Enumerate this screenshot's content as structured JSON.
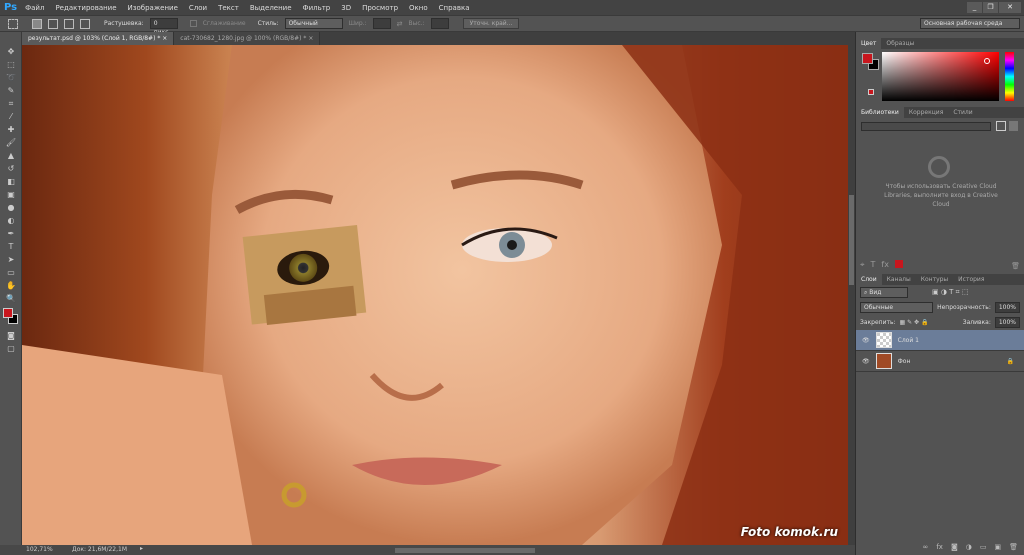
{
  "app": {
    "logo": "Ps",
    "window_buttons": [
      "_",
      "❐",
      "✕"
    ]
  },
  "menu": [
    "Файл",
    "Редактирование",
    "Изображение",
    "Слои",
    "Текст",
    "Выделение",
    "Фильтр",
    "3D",
    "Просмотр",
    "Окно",
    "Справка"
  ],
  "options": {
    "feather_label": "Растушевка:",
    "feather_value": "0 пикс.",
    "antialias": "Сглаживание",
    "style_label": "Стиль:",
    "style_value": "Обычный",
    "width_label": "Шир.:",
    "height_label": "Выс.:",
    "refine_edge": "Уточн. край...",
    "workspace": "Основная рабочая среда"
  },
  "tabs": [
    {
      "label": "результат.psd @ 103% (Слой 1, RGB/8#) *",
      "close": "×"
    },
    {
      "label": "cat-730682_1280.jpg @ 100% (RGB/8#) *",
      "close": "×"
    }
  ],
  "color_panel": {
    "tabs": [
      "Цвет",
      "Образцы"
    ],
    "foreground": "#c8161d",
    "background": "#000000"
  },
  "libraries_panel": {
    "tabs": [
      "Библиотеки",
      "Коррекция",
      "Стили"
    ],
    "message": "Чтобы использовать Creative Cloud Libraries, выполните вход в Creative Cloud"
  },
  "layers_panel": {
    "tabs": [
      "Слои",
      "Каналы",
      "Контуры",
      "История"
    ],
    "filter": "Вид",
    "blend_mode": "Обычные",
    "opacity_label": "Непрозрачность:",
    "opacity": "100%",
    "lock_label": "Закрепить:",
    "fill_label": "Заливка:",
    "fill": "100%",
    "layers": [
      {
        "name": "Слой 1",
        "selected": true
      },
      {
        "name": "Фон",
        "locked": true
      }
    ]
  },
  "status": {
    "zoom": "102,71%",
    "doc": "Док: 21,6M/22,1M"
  },
  "watermark": "Foto komok.ru"
}
